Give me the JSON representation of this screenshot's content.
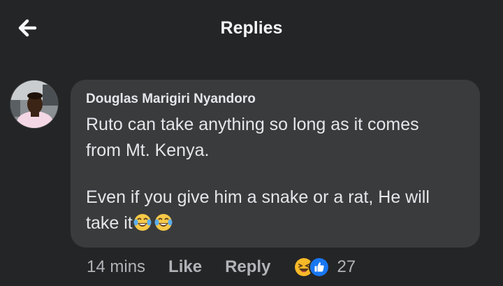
{
  "header": {
    "title": "Replies",
    "back_icon": "arrow-left-icon"
  },
  "comment": {
    "author": "Douglas Marigiri Nyandoro",
    "lines": [
      "Ruto can take anything so long as it comes",
      "from Mt. Kenya.",
      "Even if you give him a snake or a rat, He will",
      "take it"
    ],
    "trailing_emojis": [
      "face-with-tears-of-joy",
      "face-with-tears-of-joy"
    ],
    "time": "14 mins",
    "like_label": "Like",
    "reply_label": "Reply",
    "reactions": {
      "icons": [
        "haha-reaction-icon",
        "like-reaction-icon"
      ],
      "count": "27"
    }
  },
  "colors": {
    "background": "#242526",
    "bubble": "#3a3b3c",
    "text_primary": "#e4e6eb",
    "text_secondary": "#b0b3b8",
    "like_blue": "#1877f2",
    "haha_yellow": "#f7b928"
  }
}
